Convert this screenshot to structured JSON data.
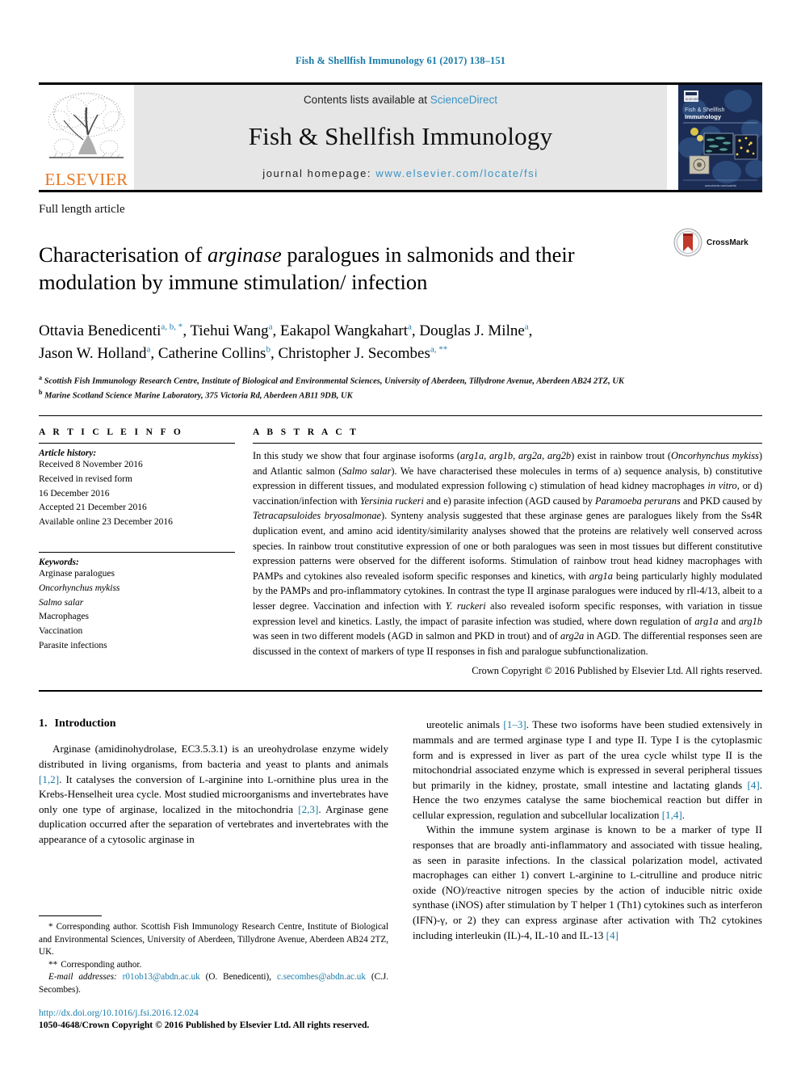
{
  "running_head": "Fish & Shellfish Immunology 61 (2017) 138–151",
  "masthead": {
    "elsevier_wordmark": "ELSEVIER",
    "contents_prefix": "Contents lists available at ",
    "contents_link": "ScienceDirect",
    "journal_title": "Fish & Shellfish Immunology",
    "homepage_prefix": "journal homepage: ",
    "homepage_url": "www.elsevier.com/locate/fsi",
    "cover_title_line1": "Fish & Shellfish",
    "cover_title_line2": "Immunology",
    "cover_footer": "www.elsevier.com/locate/fsi"
  },
  "article": {
    "type": "Full length article",
    "title_part1": "Characterisation of ",
    "title_italic": "arginase",
    "title_part2": " paralogues in salmonids and their modulation by immune stimulation/ infection",
    "crossmark_label": "CrossMark",
    "authors_line1": "Ottavia Benedicenti",
    "authors_sup1": "a, b, *",
    "authors_2": ", Tiehui Wang",
    "authors_sup2": "a",
    "authors_3": ", Eakapol Wangkahart",
    "authors_sup3": "a",
    "authors_4": ", Douglas J. Milne",
    "authors_sup4": "a",
    "authors_5": ",",
    "authors_6": "Jason W. Holland",
    "authors_sup6": "a",
    "authors_7": ", Catherine Collins",
    "authors_sup7": "b",
    "authors_8": ", Christopher J. Secombes",
    "authors_sup8": "a, **",
    "affiliation_a_sup": "a",
    "affiliation_a": "Scottish Fish Immunology Research Centre, Institute of Biological and Environmental Sciences, University of Aberdeen, Tillydrone Avenue, Aberdeen AB24 2TZ, UK",
    "affiliation_b_sup": "b",
    "affiliation_b": "Marine Scotland Science Marine Laboratory, 375 Victoria Rd, Aberdeen AB11 9DB, UK"
  },
  "article_info": {
    "heading": "A R T I C L E   I N F O",
    "history_label": "Article history:",
    "history": [
      "Received 8 November 2016",
      "Received in revised form",
      "16 December 2016",
      "Accepted 21 December 2016",
      "Available online 23 December 2016"
    ],
    "keywords_label": "Keywords:",
    "keywords": [
      {
        "text": "Arginase paralogues",
        "italic": false
      },
      {
        "text": "Oncorhynchus mykiss",
        "italic": true
      },
      {
        "text": "Salmo salar",
        "italic": true
      },
      {
        "text": "Macrophages",
        "italic": false
      },
      {
        "text": "Vaccination",
        "italic": false
      },
      {
        "text": "Parasite infections",
        "italic": false
      }
    ]
  },
  "abstract": {
    "heading": "A B S T R A C T",
    "paragraph_html": "In this study we show that four arginase isoforms (<i>arg1a</i>, <i>arg1b</i>, <i>arg2a</i>, <i>arg2b</i>) exist in rainbow trout (<i>Oncorhynchus mykiss</i>) and Atlantic salmon (<i>Salmo salar</i>). We have characterised these molecules in terms of a) sequence analysis, b) constitutive expression in different tissues, and modulated expression following c) stimulation of head kidney macrophages <i>in vitro</i>, or d) vaccination/infection with <i>Yersinia ruckeri</i> and e) parasite infection (AGD caused by <i>Paramoeba perurans</i> and PKD caused by <i>Tetracapsuloides bryosalmonae</i>). Synteny analysis suggested that these arginase genes are paralogues likely from the Ss4R duplication event, and amino acid identity/similarity analyses showed that the proteins are relatively well conserved across species. In rainbow trout constitutive expression of one or both paralogues was seen in most tissues but different constitutive expression patterns were observed for the different isoforms. Stimulation of rainbow trout head kidney macrophages with PAMPs and cytokines also revealed isoform specific responses and kinetics, with <i>arg1a</i> being particularly highly modulated by the PAMPs and pro-inflammatory cytokines. In contrast the type II arginase paralogues were induced by rIl-4/13, albeit to a lesser degree. Vaccination and infection with <i>Y. ruckeri</i> also revealed isoform specific responses, with variation in tissue expression level and kinetics. Lastly, the impact of parasite infection was studied, where down regulation of <i>arg1a</i> and <i>arg1b</i> was seen in two different models (AGD in salmon and PKD in trout) and of <i>arg2a</i> in AGD. The differential responses seen are discussed in the context of markers of type II responses in fish and paralogue subfunctionalization.",
    "copyright": "Crown Copyright © 2016 Published by Elsevier Ltd. All rights reserved."
  },
  "body": {
    "section_number": "1.",
    "section_title": "Introduction",
    "left_paragraph_html": "Arginase (amidinohydrolase, EC3.5.3.1) is an ureohydrolase enzyme widely distributed in living organisms, from bacteria and yeast to plants and animals <span class=\"ref\">[1,2]</span>. It catalyses the conversion of <span class=\"sc\">L</span>-arginine into <span class=\"sc\">L</span>-ornithine plus urea in the Krebs-Henselheit urea cycle. Most studied microorganisms and invertebrates have only one type of arginase, localized in the mitochondria <span class=\"ref\">[2,3]</span>. Arginase gene duplication occurred after the separation of vertebrates and invertebrates with the appearance of a cytosolic arginase in",
    "right_paragraph1_html": "ureotelic animals <span class=\"ref\">[1–3]</span>. These two isoforms have been studied extensively in mammals and are termed arginase type I and type II. Type I is the cytoplasmic form and is expressed in liver as part of the urea cycle whilst type II is the mitochondrial associated enzyme which is expressed in several peripheral tissues but primarily in the kidney, prostate, small intestine and lactating glands <span class=\"ref\">[4]</span>. Hence the two enzymes catalyse the same biochemical reaction but differ in cellular expression, regulation and subcellular localization <span class=\"ref\">[1,4]</span>.",
    "right_paragraph2_html": "Within the immune system arginase is known to be a marker of type II responses that are broadly anti-inflammatory and associated with tissue healing, as seen in parasite infections. In the classical polarization model, activated macrophages can either 1) convert <span class=\"sc\">L</span>-arginine to <span class=\"sc\">L</span>-citrulline and produce nitric oxide (NO)/reactive nitrogen species by the action of inducible nitric oxide synthase (iNOS) after stimulation by T helper 1 (Th1) cytokines such as interferon (IFN)-γ, or 2) they can express arginase after activation with Th2 cytokines including interleukin (IL)-4, IL-10 and IL-13 <span class=\"ref\">[4]</span>"
  },
  "footnotes": {
    "corresponding1_marker": "*",
    "corresponding1_text": "Corresponding author. Scottish Fish Immunology Research Centre, Institute of Biological and Environmental Sciences, University of Aberdeen, Tillydrone Avenue, Aberdeen AB24 2TZ, UK.",
    "corresponding2_marker": "**",
    "corresponding2_text": "Corresponding author.",
    "email_label": "E-mail addresses:",
    "email1": "r01ob13@abdn.ac.uk",
    "email1_owner": "(O. Benedicenti)",
    "email2": "c.secombes@abdn.ac.uk",
    "email2_owner": "(C.J. Secombes).",
    "doi": "http://dx.doi.org/10.1016/j.fsi.2016.12.024",
    "issn_line": "1050-4648/Crown Copyright © 2016 Published by Elsevier Ltd. All rights reserved."
  },
  "colors": {
    "link_blue": "#1a7ca8",
    "sciencedirect_blue": "#3a93c4",
    "elsevier_orange": "#e87722",
    "masthead_gray": "#e6e6e6"
  }
}
